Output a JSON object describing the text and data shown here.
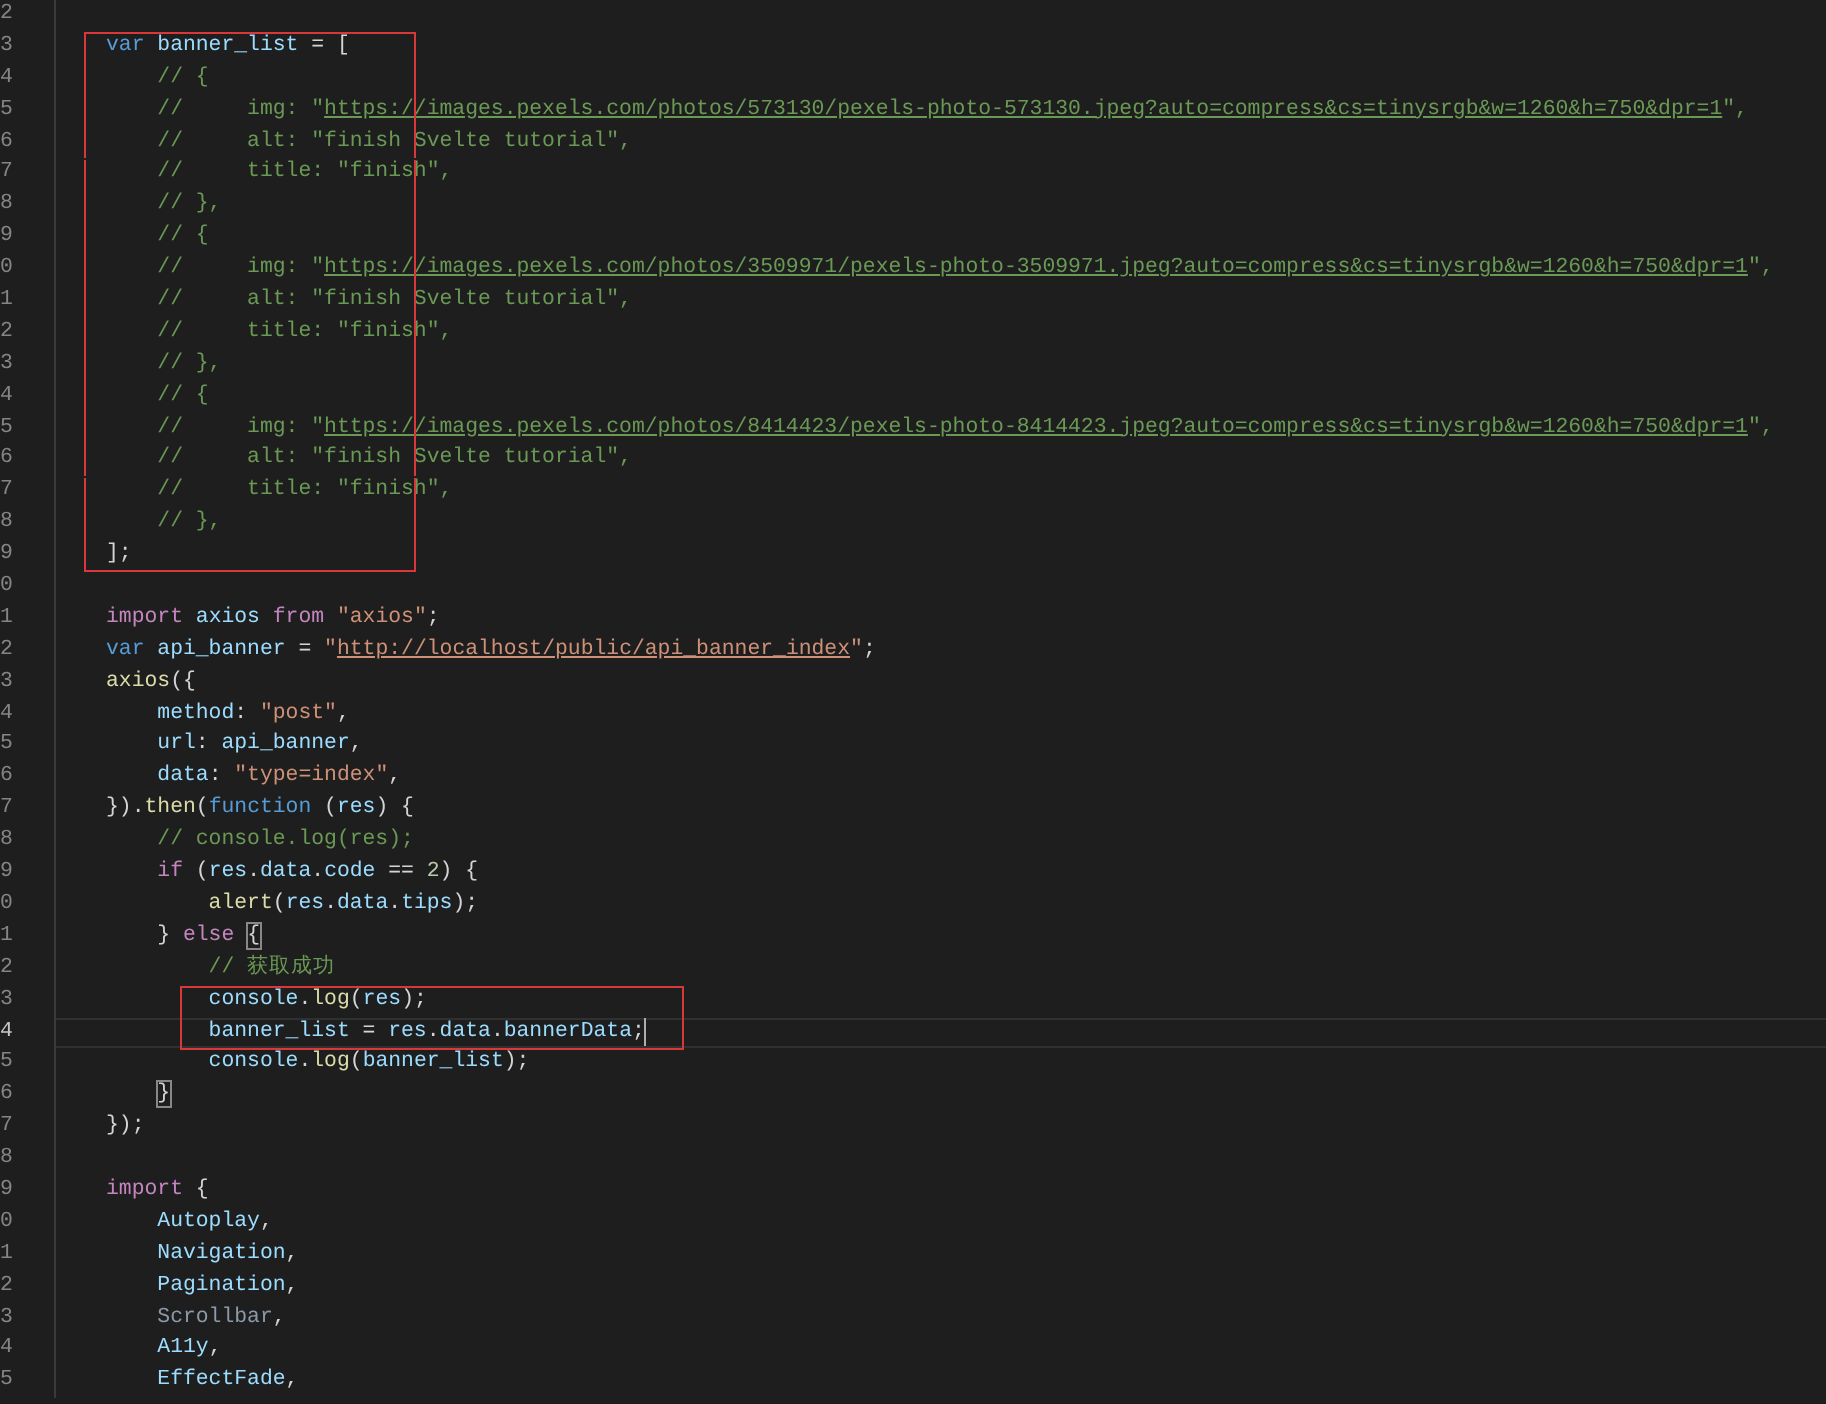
{
  "editor": {
    "lines": [
      {
        "number": "2",
        "current": false,
        "boxed": false
      },
      {
        "number": "3",
        "current": false,
        "boxed": true,
        "tokens": [
          {
            "kind": "kw",
            "text": "var "
          },
          {
            "kind": "var",
            "text": "banner_list"
          },
          {
            "kind": "punc",
            "text": " = ["
          }
        ]
      },
      {
        "number": "4",
        "current": false,
        "boxed": true,
        "tokens": [
          {
            "kind": "com",
            "text": "    // {"
          }
        ]
      },
      {
        "number": "5",
        "current": false,
        "boxed": true,
        "tokens": [
          {
            "kind": "com",
            "text": "    //     img: \""
          },
          {
            "kind": "comlink",
            "text": "https://images.pexels.com/photos/573130/pexels-photo-573130.jpeg?auto=compress&cs=tinysrgb&w=1260&h=750&dpr=1"
          },
          {
            "kind": "com",
            "text": "\","
          }
        ]
      },
      {
        "number": "6",
        "current": false,
        "boxed": true,
        "tokens": [
          {
            "kind": "com",
            "text": "    //     alt: \"finish Svelte tutorial\","
          }
        ]
      },
      {
        "number": "7",
        "current": false,
        "boxed": true,
        "tokens": [
          {
            "kind": "com",
            "text": "    //     title: \"finish\","
          }
        ]
      },
      {
        "number": "8",
        "current": false,
        "boxed": true,
        "tokens": [
          {
            "kind": "com",
            "text": "    // },"
          }
        ]
      },
      {
        "number": "9",
        "current": false,
        "boxed": true,
        "tokens": [
          {
            "kind": "com",
            "text": "    // {"
          }
        ]
      },
      {
        "number": "0",
        "current": false,
        "boxed": true,
        "tokens": [
          {
            "kind": "com",
            "text": "    //     img: \""
          },
          {
            "kind": "comlink",
            "text": "https://images.pexels.com/photos/3509971/pexels-photo-3509971.jpeg?auto=compress&cs=tinysrgb&w=1260&h=750&dpr=1"
          },
          {
            "kind": "com",
            "text": "\","
          }
        ]
      },
      {
        "number": "1",
        "current": false,
        "boxed": true,
        "tokens": [
          {
            "kind": "com",
            "text": "    //     alt: \"finish Svelte tutorial\","
          }
        ]
      },
      {
        "number": "2",
        "current": false,
        "boxed": true,
        "tokens": [
          {
            "kind": "com",
            "text": "    //     title: \"finish\","
          }
        ]
      },
      {
        "number": "3",
        "current": false,
        "boxed": true,
        "tokens": [
          {
            "kind": "com",
            "text": "    // },"
          }
        ]
      },
      {
        "number": "4",
        "current": false,
        "boxed": true,
        "tokens": [
          {
            "kind": "com",
            "text": "    // {"
          }
        ]
      },
      {
        "number": "5",
        "current": false,
        "boxed": true,
        "tokens": [
          {
            "kind": "com",
            "text": "    //     img: \""
          },
          {
            "kind": "comlink",
            "text": "https://images.pexels.com/photos/8414423/pexels-photo-8414423.jpeg?auto=compress&cs=tinysrgb&w=1260&h=750&dpr=1"
          },
          {
            "kind": "com",
            "text": "\","
          }
        ]
      },
      {
        "number": "6",
        "current": false,
        "boxed": true,
        "tokens": [
          {
            "kind": "com",
            "text": "    //     alt: \"finish Svelte tutorial\","
          }
        ]
      },
      {
        "number": "7",
        "current": false,
        "boxed": true,
        "tokens": [
          {
            "kind": "com",
            "text": "    //     title: \"finish\","
          }
        ]
      },
      {
        "number": "8",
        "current": false,
        "boxed": true,
        "tokens": [
          {
            "kind": "com",
            "text": "    // },"
          }
        ]
      },
      {
        "number": "9",
        "current": false,
        "boxed": true,
        "tokens": [
          {
            "kind": "punc",
            "text": "];"
          }
        ]
      },
      {
        "number": "0",
        "current": false,
        "boxed": false
      },
      {
        "number": "1",
        "current": false,
        "boxed": false,
        "tokens": [
          {
            "kind": "ctl",
            "text": "import "
          },
          {
            "kind": "var",
            "text": "axios"
          },
          {
            "kind": "ctl",
            "text": " from "
          },
          {
            "kind": "str",
            "text": "\"axios\""
          },
          {
            "kind": "punc",
            "text": ";"
          }
        ]
      },
      {
        "number": "2",
        "current": false,
        "boxed": false,
        "tokens": [
          {
            "kind": "kw",
            "text": "var "
          },
          {
            "kind": "var",
            "text": "api_banner"
          },
          {
            "kind": "punc",
            "text": " = "
          },
          {
            "kind": "str",
            "text": "\""
          },
          {
            "kind": "link",
            "text": "http://localhost/public/api_banner_index"
          },
          {
            "kind": "str",
            "text": "\""
          },
          {
            "kind": "punc",
            "text": ";"
          }
        ]
      },
      {
        "number": "3",
        "current": false,
        "boxed": false,
        "tokens": [
          {
            "kind": "fn",
            "text": "axios"
          },
          {
            "kind": "punc",
            "text": "({"
          }
        ]
      },
      {
        "number": "4",
        "current": false,
        "boxed": false,
        "tokens": [
          {
            "kind": "var",
            "text": "    method"
          },
          {
            "kind": "punc",
            "text": ": "
          },
          {
            "kind": "str",
            "text": "\"post\""
          },
          {
            "kind": "punc",
            "text": ","
          }
        ]
      },
      {
        "number": "5",
        "current": false,
        "boxed": false,
        "tokens": [
          {
            "kind": "var",
            "text": "    url"
          },
          {
            "kind": "punc",
            "text": ": "
          },
          {
            "kind": "var",
            "text": "api_banner"
          },
          {
            "kind": "punc",
            "text": ","
          }
        ]
      },
      {
        "number": "6",
        "current": false,
        "boxed": false,
        "tokens": [
          {
            "kind": "var",
            "text": "    data"
          },
          {
            "kind": "punc",
            "text": ": "
          },
          {
            "kind": "str",
            "text": "\"type=index\""
          },
          {
            "kind": "punc",
            "text": ","
          }
        ]
      },
      {
        "number": "7",
        "current": false,
        "boxed": false,
        "tokens": [
          {
            "kind": "punc",
            "text": "})."
          },
          {
            "kind": "fn",
            "text": "then"
          },
          {
            "kind": "punc",
            "text": "("
          },
          {
            "kind": "kw",
            "text": "function"
          },
          {
            "kind": "punc",
            "text": " ("
          },
          {
            "kind": "var",
            "text": "res"
          },
          {
            "kind": "punc",
            "text": ") {"
          }
        ]
      },
      {
        "number": "8",
        "current": false,
        "boxed": false,
        "tokens": [
          {
            "kind": "com",
            "text": "    // console.log(res);"
          }
        ]
      },
      {
        "number": "9",
        "current": false,
        "boxed": false,
        "tokens": [
          {
            "kind": "ctl",
            "text": "    if"
          },
          {
            "kind": "punc",
            "text": " ("
          },
          {
            "kind": "var",
            "text": "res"
          },
          {
            "kind": "punc",
            "text": "."
          },
          {
            "kind": "var",
            "text": "data"
          },
          {
            "kind": "punc",
            "text": "."
          },
          {
            "kind": "var",
            "text": "code"
          },
          {
            "kind": "punc",
            "text": " == "
          },
          {
            "kind": "num",
            "text": "2"
          },
          {
            "kind": "punc",
            "text": ") {"
          }
        ]
      },
      {
        "number": "0",
        "current": false,
        "boxed": false,
        "tokens": [
          {
            "kind": "fn",
            "text": "        alert"
          },
          {
            "kind": "punc",
            "text": "("
          },
          {
            "kind": "var",
            "text": "res"
          },
          {
            "kind": "punc",
            "text": "."
          },
          {
            "kind": "var",
            "text": "data"
          },
          {
            "kind": "punc",
            "text": "."
          },
          {
            "kind": "var",
            "text": "tips"
          },
          {
            "kind": "punc",
            "text": ");"
          }
        ]
      },
      {
        "number": "1",
        "current": false,
        "boxed": false,
        "tokens": [
          {
            "kind": "punc",
            "text": "    } "
          },
          {
            "kind": "ctl",
            "text": "else "
          },
          {
            "kind": "match",
            "text": "{"
          }
        ]
      },
      {
        "number": "2",
        "current": false,
        "boxed": false,
        "tokens": [
          {
            "kind": "com",
            "text": "        // 获取成功"
          }
        ]
      },
      {
        "number": "3",
        "current": false,
        "boxed": true,
        "tokens": [
          {
            "kind": "var",
            "text": "        console"
          },
          {
            "kind": "punc",
            "text": "."
          },
          {
            "kind": "fn",
            "text": "log"
          },
          {
            "kind": "punc",
            "text": "("
          },
          {
            "kind": "var",
            "text": "res"
          },
          {
            "kind": "punc",
            "text": ");"
          }
        ]
      },
      {
        "number": "4",
        "current": true,
        "boxed": true,
        "tokens": [
          {
            "kind": "var",
            "text": "        banner_list"
          },
          {
            "kind": "punc",
            "text": " = "
          },
          {
            "kind": "var",
            "text": "res"
          },
          {
            "kind": "punc",
            "text": "."
          },
          {
            "kind": "var",
            "text": "data"
          },
          {
            "kind": "punc",
            "text": "."
          },
          {
            "kind": "var",
            "text": "bannerData"
          },
          {
            "kind": "punc",
            "text": ";"
          }
        ]
      },
      {
        "number": "5",
        "current": false,
        "boxed": false,
        "tokens": [
          {
            "kind": "var",
            "text": "        console"
          },
          {
            "kind": "punc",
            "text": "."
          },
          {
            "kind": "fn",
            "text": "log"
          },
          {
            "kind": "punc",
            "text": "("
          },
          {
            "kind": "var",
            "text": "banner_list"
          },
          {
            "kind": "punc",
            "text": ");"
          }
        ]
      },
      {
        "number": "6",
        "current": false,
        "boxed": false,
        "tokens": [
          {
            "kind": "match",
            "text": "    }"
          }
        ]
      },
      {
        "number": "7",
        "current": false,
        "boxed": false,
        "tokens": [
          {
            "kind": "punc",
            "text": "});"
          }
        ]
      },
      {
        "number": "8",
        "current": false,
        "boxed": false
      },
      {
        "number": "9",
        "current": false,
        "boxed": false,
        "tokens": [
          {
            "kind": "ctl",
            "text": "import"
          },
          {
            "kind": "punc",
            "text": " {"
          }
        ]
      },
      {
        "number": "0",
        "current": false,
        "boxed": false,
        "tokens": [
          {
            "kind": "var",
            "text": "    Autoplay"
          },
          {
            "kind": "punc",
            "text": ","
          }
        ]
      },
      {
        "number": "1",
        "current": false,
        "boxed": false,
        "tokens": [
          {
            "kind": "var",
            "text": "    Navigation"
          },
          {
            "kind": "punc",
            "text": ","
          }
        ]
      },
      {
        "number": "2",
        "current": false,
        "boxed": false,
        "tokens": [
          {
            "kind": "var",
            "text": "    Pagination"
          },
          {
            "kind": "punc",
            "text": ","
          }
        ]
      },
      {
        "number": "3",
        "current": false,
        "boxed": false,
        "tokens": [
          {
            "kind": "dim",
            "text": "    Scrollbar"
          },
          {
            "kind": "punc",
            "text": ","
          }
        ]
      },
      {
        "number": "4",
        "current": false,
        "boxed": false,
        "tokens": [
          {
            "kind": "var",
            "text": "    A11y"
          },
          {
            "kind": "punc",
            "text": ","
          }
        ]
      },
      {
        "number": "5",
        "current": false,
        "boxed": false,
        "tokens": [
          {
            "kind": "var",
            "text": "    EffectFade"
          },
          {
            "kind": "punc",
            "text": ","
          }
        ]
      }
    ]
  }
}
